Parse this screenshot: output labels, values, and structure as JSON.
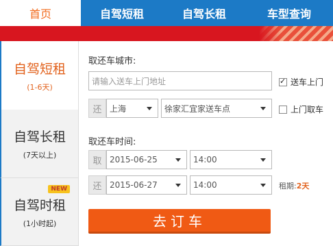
{
  "nav": {
    "home": "首页",
    "tab1": "自驾短租",
    "tab2": "自驾长租",
    "tab3": "车型查询"
  },
  "side": {
    "short": {
      "title": "自驾短租",
      "sub": "(1-6天)"
    },
    "long": {
      "title": "自驾长租",
      "sub": "(7天以上)"
    },
    "hourly": {
      "title": "自驾时租",
      "sub": "(1小时起)",
      "badge": "NEW"
    }
  },
  "form": {
    "city_label": "取还车城市:",
    "address_placeholder": "请输入送车上门地址",
    "deliver_label": "送车上门",
    "deliver_checked": true,
    "return_tag": "还",
    "city_value": "上海",
    "store_value": "徐家汇宜家送车点",
    "pickup_home_label": "上门取车",
    "pickup_home_checked": false,
    "time_label": "取还车时间:",
    "pick_tag": "取",
    "pick_date": "2015-06-25",
    "pick_time": "14:00",
    "ret_tag": "还",
    "ret_date": "2015-06-27",
    "ret_time": "14:00",
    "lease_label": "租期:",
    "lease_value": "2天",
    "submit_label": "去订车"
  }
}
